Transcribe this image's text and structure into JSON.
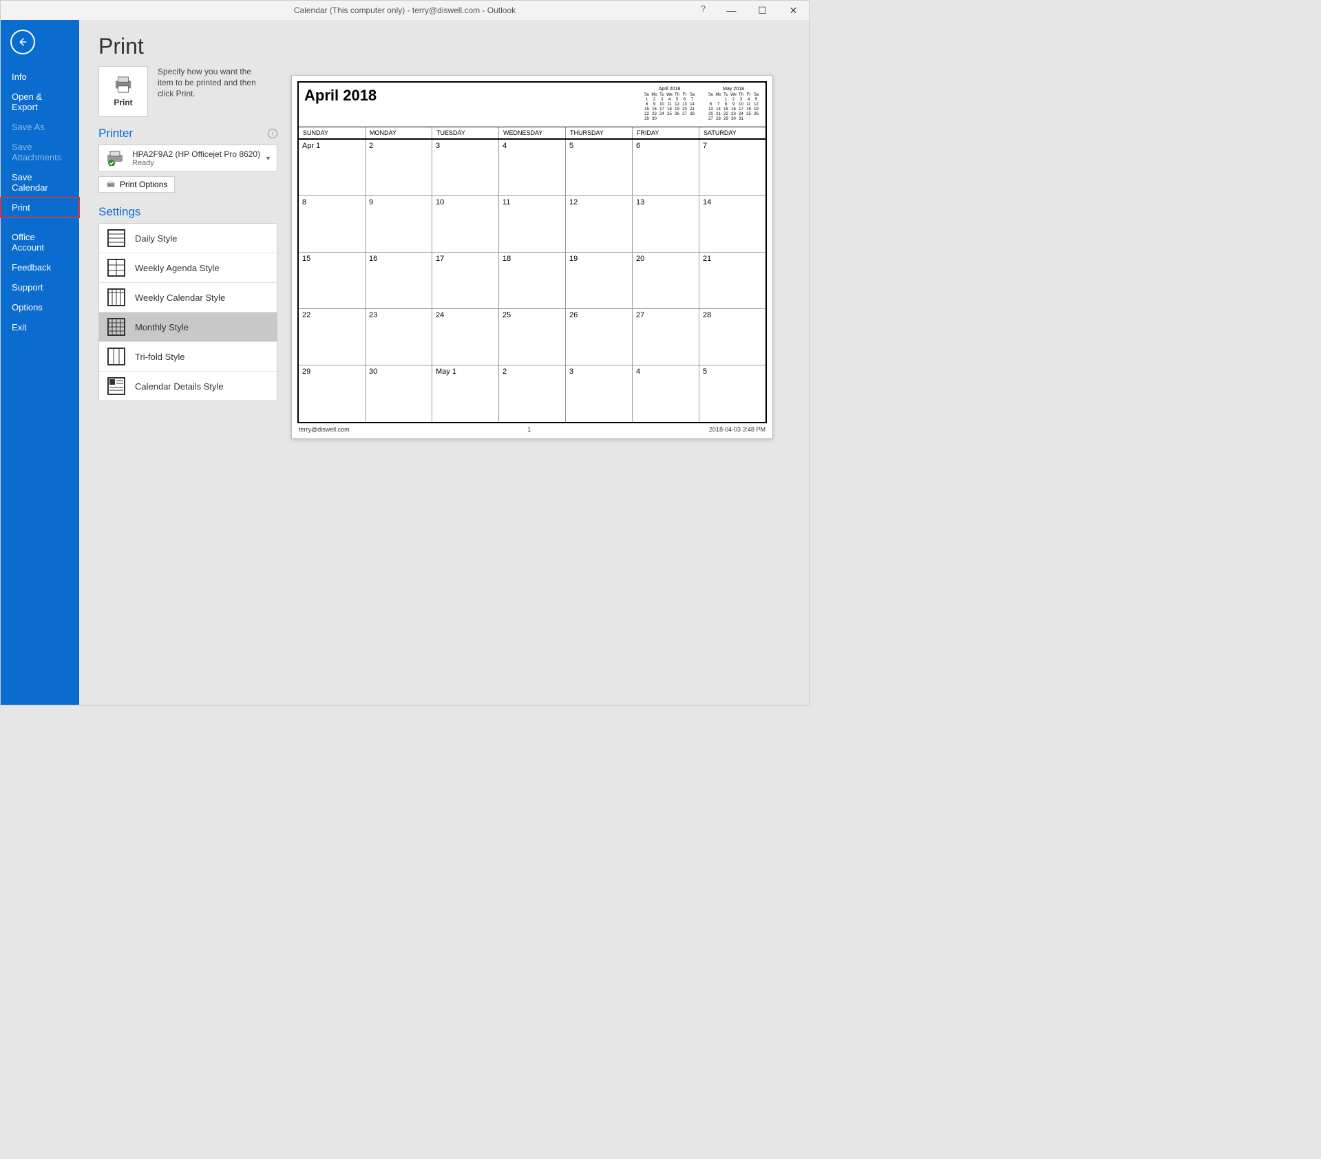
{
  "titlebar": "Calendar (This computer only) - terry@diswell.com  -  Outlook",
  "sidebar": {
    "items": [
      {
        "label": "Info",
        "state": "normal"
      },
      {
        "label": "Open & Export",
        "state": "normal"
      },
      {
        "label": "Save As",
        "state": "disabled"
      },
      {
        "label": "Save Attachments",
        "state": "disabled"
      },
      {
        "label": "Save Calendar",
        "state": "normal"
      },
      {
        "label": "Print",
        "state": "selected"
      },
      {
        "label": "Office Account",
        "state": "normal"
      },
      {
        "label": "Feedback",
        "state": "normal"
      },
      {
        "label": "Support",
        "state": "normal"
      },
      {
        "label": "Options",
        "state": "normal"
      },
      {
        "label": "Exit",
        "state": "normal"
      }
    ]
  },
  "page": {
    "title": "Print",
    "print_button": "Print",
    "description": "Specify how you want the item to be printed and then click Print.",
    "printer_section": "Printer",
    "printer_name": "HPA2F9A2 (HP Officejet Pro 8620)",
    "printer_status": "Ready",
    "print_options": "Print Options",
    "settings_section": "Settings",
    "styles": [
      "Daily Style",
      "Weekly Agenda Style",
      "Weekly Calendar Style",
      "Monthly Style",
      "Tri-fold Style",
      "Calendar Details Style"
    ],
    "selected_style": "Monthly Style"
  },
  "preview": {
    "month_title": "April 2018",
    "day_headers": [
      "SUNDAY",
      "MONDAY",
      "TUESDAY",
      "WEDNESDAY",
      "THURSDAY",
      "FRIDAY",
      "SATURDAY"
    ],
    "cells": [
      [
        "Apr 1",
        "2",
        "3",
        "4",
        "5",
        "6",
        "7"
      ],
      [
        "8",
        "9",
        "10",
        "11",
        "12",
        "13",
        "14"
      ],
      [
        "15",
        "16",
        "17",
        "18",
        "19",
        "20",
        "21"
      ],
      [
        "22",
        "23",
        "24",
        "25",
        "26",
        "27",
        "28"
      ],
      [
        "29",
        "30",
        "May 1",
        "2",
        "3",
        "4",
        "5"
      ]
    ],
    "footer_left": "terry@diswell.com",
    "footer_center": "1",
    "footer_right": "2018-04-03 3:48 PM",
    "mini": [
      {
        "title": "April 2018",
        "hdr": [
          "Su",
          "Mo",
          "Tu",
          "We",
          "Th",
          "Fr",
          "Sa"
        ],
        "rows": [
          [
            "1",
            "2",
            "3",
            "4",
            "5",
            "6",
            "7"
          ],
          [
            "8",
            "9",
            "10",
            "11",
            "12",
            "13",
            "14"
          ],
          [
            "15",
            "16",
            "17",
            "18",
            "19",
            "20",
            "21"
          ],
          [
            "22",
            "23",
            "24",
            "25",
            "26",
            "27",
            "28"
          ],
          [
            "29",
            "30",
            "",
            "",
            "",
            "",
            ""
          ]
        ]
      },
      {
        "title": "May 2018",
        "hdr": [
          "Su",
          "Mo",
          "Tu",
          "We",
          "Th",
          "Fr",
          "Sa"
        ],
        "rows": [
          [
            "",
            "",
            "1",
            "2",
            "3",
            "4",
            "5"
          ],
          [
            "6",
            "7",
            "8",
            "9",
            "10",
            "11",
            "12"
          ],
          [
            "13",
            "14",
            "15",
            "16",
            "17",
            "18",
            "19"
          ],
          [
            "20",
            "21",
            "22",
            "23",
            "24",
            "25",
            "26"
          ],
          [
            "27",
            "28",
            "29",
            "30",
            "31",
            "",
            ""
          ]
        ]
      }
    ]
  }
}
